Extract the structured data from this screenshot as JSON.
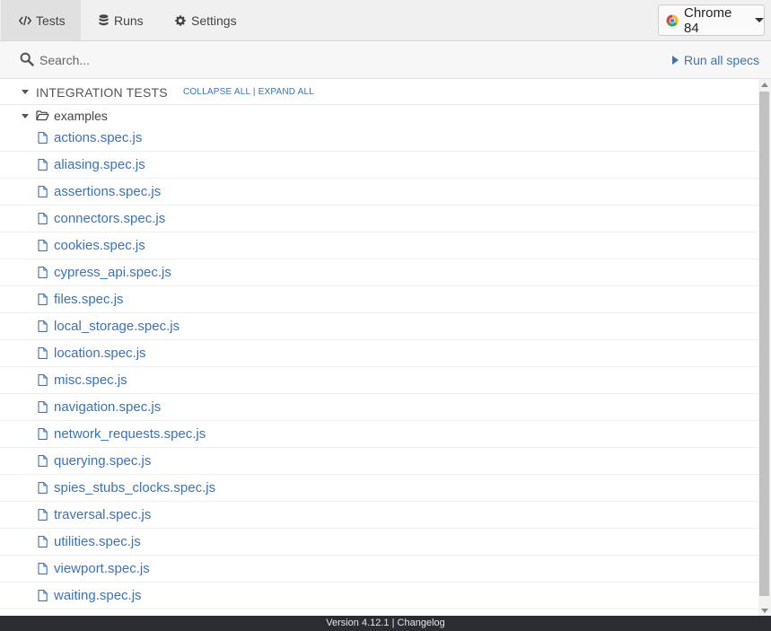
{
  "nav": {
    "tabs": [
      {
        "label": "Tests",
        "icon": "code-icon",
        "active": true
      },
      {
        "label": "Runs",
        "icon": "database-icon",
        "active": false
      },
      {
        "label": "Settings",
        "icon": "gear-icon",
        "active": false
      }
    ],
    "browser": {
      "label": "Chrome 84",
      "icon": "chrome-icon"
    }
  },
  "search": {
    "placeholder": "Search...",
    "run_all_label": "Run all specs"
  },
  "section": {
    "title": "INTEGRATION TESTS",
    "collapse_all": "COLLAPSE ALL",
    "separator": "|",
    "expand_all": "EXPAND ALL"
  },
  "folder": {
    "name": "examples",
    "files": [
      "actions.spec.js",
      "aliasing.spec.js",
      "assertions.spec.js",
      "connectors.spec.js",
      "cookies.spec.js",
      "cypress_api.spec.js",
      "files.spec.js",
      "local_storage.spec.js",
      "location.spec.js",
      "misc.spec.js",
      "navigation.spec.js",
      "network_requests.spec.js",
      "querying.spec.js",
      "spies_stubs_clocks.spec.js",
      "traversal.spec.js",
      "utilities.spec.js",
      "viewport.spec.js",
      "waiting.spec.js"
    ]
  },
  "footer": {
    "version": "Version 4.12.1",
    "separator": "|",
    "changelog": "Changelog"
  },
  "colors": {
    "link": "#3a73b8",
    "footer_bg": "#2b2d33"
  }
}
